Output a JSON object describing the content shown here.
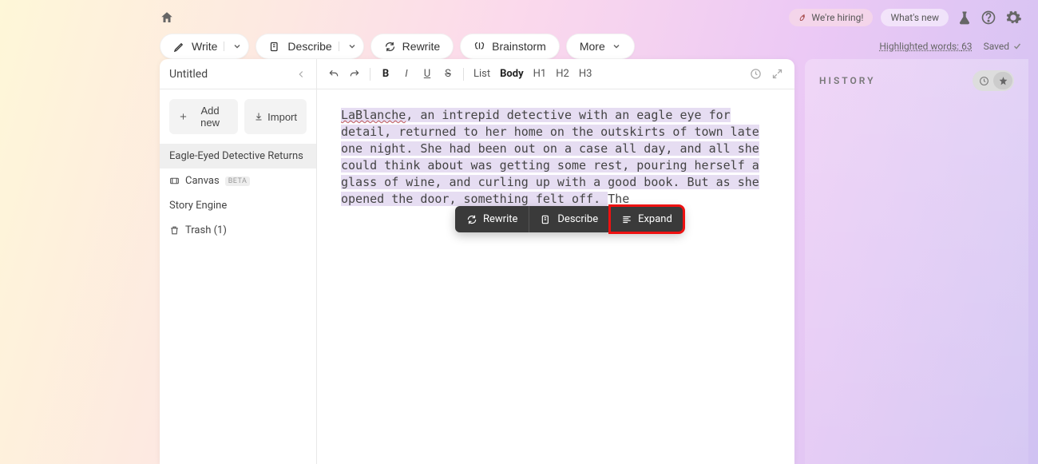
{
  "header": {
    "hiring": "We're hiring!",
    "whatsnew": "What's new"
  },
  "actionbar": {
    "write": "Write",
    "describe": "Describe",
    "rewrite": "Rewrite",
    "brainstorm": "Brainstorm",
    "more": "More"
  },
  "status": {
    "highlighted_label": "Highlighted words: ",
    "highlighted_count": "63",
    "saved": "Saved"
  },
  "sidebar": {
    "title": "Untitled",
    "add": "Add new",
    "import": "Import",
    "items": [
      {
        "label": "Eagle-Eyed Detective Returns"
      },
      {
        "label": "Canvas",
        "badge": "BETA"
      },
      {
        "label": "Story Engine"
      },
      {
        "label": "Trash (1)"
      }
    ]
  },
  "format": {
    "list": "List",
    "body": "Body",
    "h1": "H1",
    "h2": "H2",
    "h3": "H3"
  },
  "document": {
    "name": "LaBlanche",
    "highlighted": ", an intrepid detective with an eagle eye for detail, returned to her home on the outskirts of town late one night. She had been out on a case all day, and all she could think about was getting some rest, pouring herself a glass of wine, and curling up with a good book. But as she opened the door, something felt off. ",
    "after": "The"
  },
  "selection_toolbar": {
    "rewrite": "Rewrite",
    "describe": "Describe",
    "expand": "Expand"
  },
  "history": {
    "title": "HISTORY"
  }
}
